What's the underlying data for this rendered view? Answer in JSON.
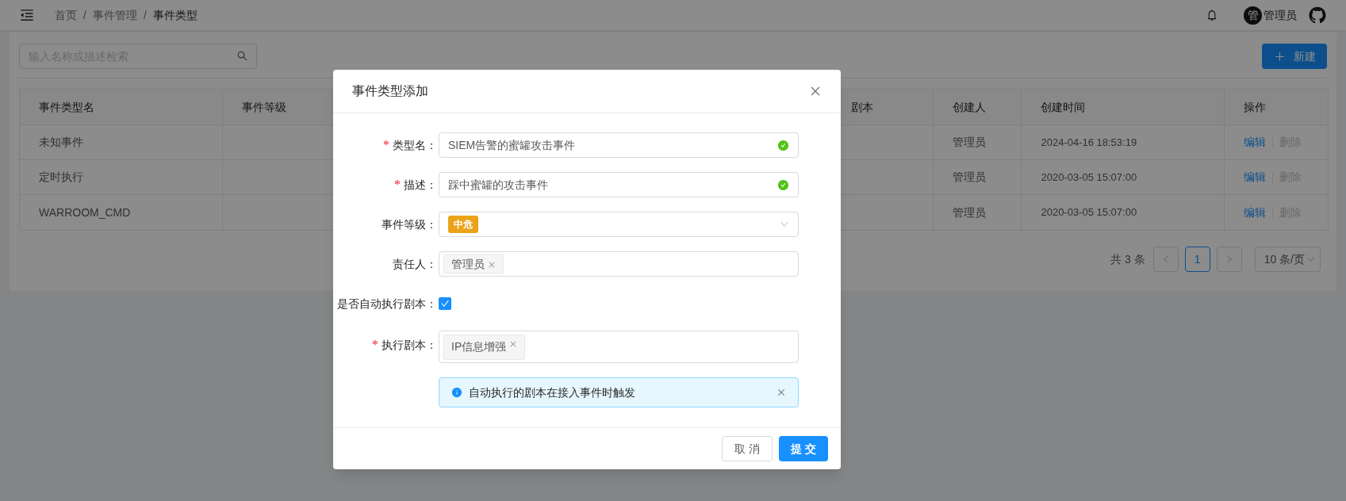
{
  "header": {
    "breadcrumb": [
      {
        "kind": "link",
        "label": "首页"
      },
      {
        "kind": "separator",
        "label": "/"
      },
      {
        "kind": "link",
        "label": "事件管理"
      },
      {
        "kind": "separator",
        "label": "/"
      },
      {
        "kind": "current",
        "label": "事件类型"
      }
    ],
    "user": {
      "avatar_text": "管",
      "name": "管理员"
    }
  },
  "toolbar": {
    "search": {
      "placeholder": "输入名称或描述检索"
    },
    "new_button": "新建"
  },
  "table": {
    "columns": [
      "事件类型名",
      "事件等级",
      "剧本",
      "创建人",
      "创建时间",
      "操作"
    ],
    "rows": [
      {
        "name": "未知事件",
        "creator": "管理员",
        "created": "2024-04-16 18:53:19",
        "actions": [
          {
            "label": "编辑",
            "disabled": false
          },
          {
            "label": "删除",
            "disabled": true
          }
        ]
      },
      {
        "name": "定时执行",
        "creator": "管理员",
        "created": "2020-03-05 15:07:00",
        "actions": [
          {
            "label": "编辑",
            "disabled": false
          },
          {
            "label": "删除",
            "disabled": true
          }
        ]
      },
      {
        "name": "WARROOM_CMD",
        "creator": "管理员",
        "created": "2020-03-05 15:07:00",
        "actions": [
          {
            "label": "编辑",
            "disabled": false
          },
          {
            "label": "删除",
            "disabled": true
          }
        ]
      }
    ]
  },
  "pagination": {
    "total": "共 3 条",
    "pages": [
      {
        "label": "1",
        "selected": true
      }
    ],
    "page_size": "10 条/页"
  },
  "dialog": {
    "title": "事件类型添加",
    "fields": [
      {
        "kind": "text",
        "mark": "*",
        "label": "类型名：",
        "value": "SIEM告警的蜜罐攻击事件",
        "valid": true
      },
      {
        "kind": "text",
        "mark": "*",
        "label": "描述：",
        "value": "踩中蜜罐的攻击事件",
        "valid": true
      },
      {
        "kind": "select",
        "label": "事件等级：",
        "tag": "中危"
      },
      {
        "kind": "tags",
        "label": "责任人：",
        "tags": [
          "管理员"
        ]
      },
      {
        "kind": "checkbox",
        "label": "是否自动执行剧本：",
        "checked": true
      },
      {
        "kind": "tags_tall",
        "mark": "*",
        "label": "执行剧本：",
        "tags": [
          "IP信息增强"
        ]
      }
    ],
    "alert": "自动执行的剧本在接入事件时触发",
    "buttons": [
      {
        "kind": "default",
        "label": "取 消"
      },
      {
        "kind": "primary",
        "label": "提 交"
      }
    ]
  }
}
